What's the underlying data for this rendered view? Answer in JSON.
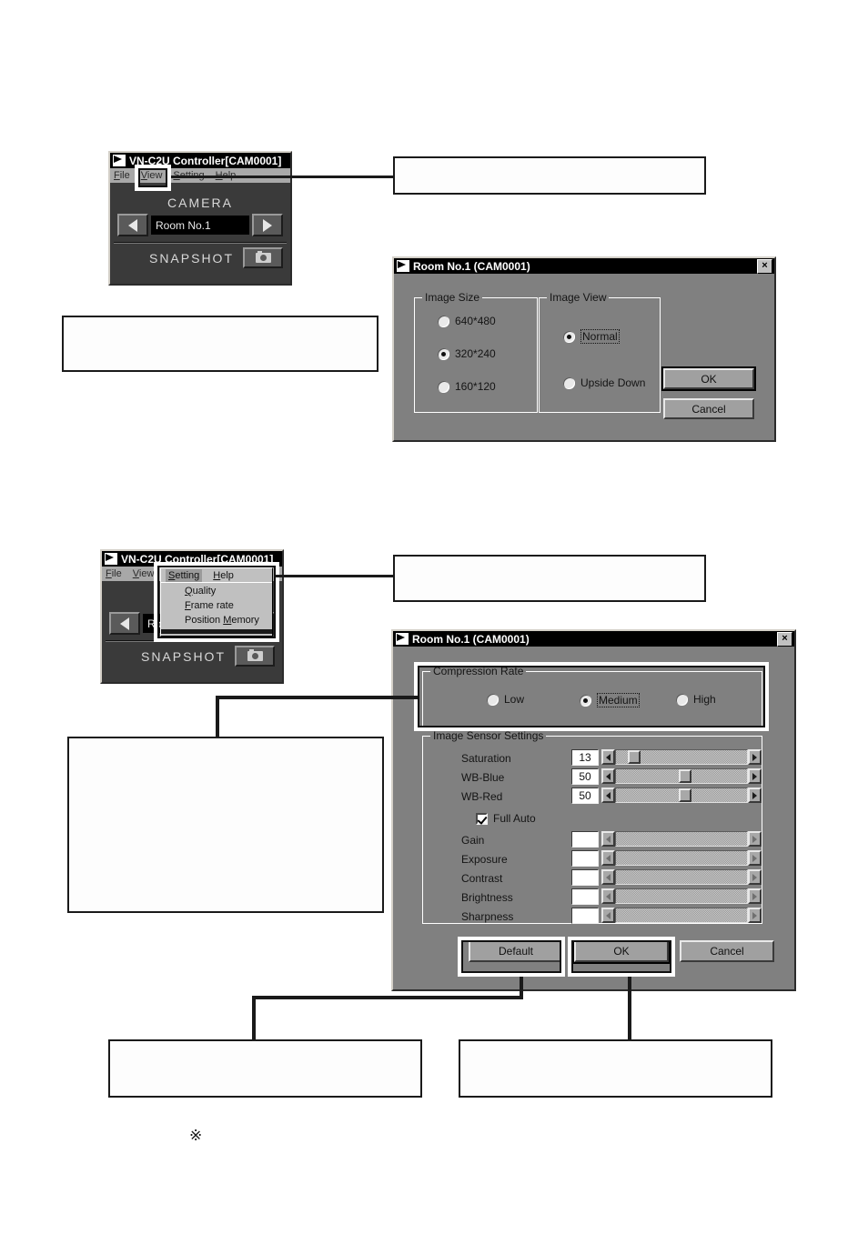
{
  "document": {
    "reference_mark": "※"
  },
  "controller_top": {
    "title": "VN-C2U Controller[CAM0001]",
    "menu": [
      "File",
      "View",
      "Setting",
      "Help"
    ],
    "camera_label": "CAMERA",
    "camera_value": "Room No.1",
    "prev_icon": "triangle-left-icon",
    "next_icon": "triangle-right-icon",
    "snapshot_label": "SNAPSHOT",
    "snapshot_icon": "camera-icon",
    "highlighted_menu": "View"
  },
  "dialog_view": {
    "title": "Room No.1  (CAM0001)",
    "close_label": "×",
    "image_size": {
      "legend": "Image Size",
      "options": [
        "640*480",
        "320*240",
        "160*120"
      ],
      "selected": "320*240"
    },
    "image_view": {
      "legend": "Image View",
      "options": [
        "Normal",
        "Upside Down"
      ],
      "selected": "Normal"
    },
    "buttons": {
      "ok": "OK",
      "cancel": "Cancel"
    }
  },
  "controller_bottom": {
    "title": "VN-C2U Controller[CAM0001]",
    "menu": [
      "File",
      "View"
    ],
    "camera_value": "Room No.1",
    "snapshot_label": "SNAPSHOT",
    "snapshot_icon": "camera-icon",
    "popup": {
      "menubar": [
        "Setting",
        "Help"
      ],
      "open_menu": "Setting",
      "items": [
        "Quality",
        "Frame rate",
        "Position Memory"
      ]
    }
  },
  "dialog_quality": {
    "title": "Room No.1  (CAM0001)",
    "close_label": "×",
    "compression": {
      "legend": "Compression Rate",
      "options": [
        "Low",
        "Medium",
        "High"
      ],
      "selected": "Medium"
    },
    "sensor": {
      "legend": "Image Sensor Settings",
      "rows": [
        {
          "label": "Saturation",
          "value": "13",
          "enabled": true,
          "thumb_pct": 9
        },
        {
          "label": "WB-Blue",
          "value": "50",
          "enabled": true,
          "thumb_pct": 48
        },
        {
          "label": "WB-Red",
          "value": "50",
          "enabled": true,
          "thumb_pct": 48
        }
      ],
      "full_auto": {
        "label": "Full Auto",
        "checked": true
      },
      "auto_rows": [
        {
          "label": "Gain",
          "value": "",
          "enabled": false
        },
        {
          "label": "Exposure",
          "value": "",
          "enabled": false
        },
        {
          "label": "Contrast",
          "value": "",
          "enabled": false
        },
        {
          "label": "Brightness",
          "value": "",
          "enabled": false
        },
        {
          "label": "Sharpness",
          "value": "",
          "enabled": false
        }
      ]
    },
    "buttons": {
      "default": "Default",
      "ok": "OK",
      "cancel": "Cancel"
    }
  },
  "callouts": {
    "view_menu_note": "",
    "image_size_note": "",
    "setting_menu_note": "",
    "compression_note": "",
    "default_note": "",
    "ok_note": ""
  }
}
